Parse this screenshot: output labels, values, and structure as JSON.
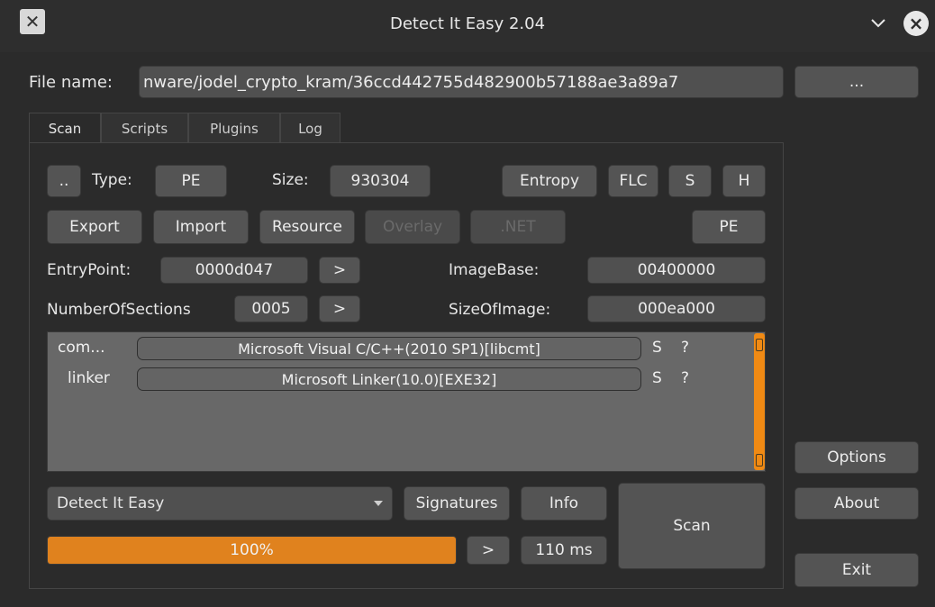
{
  "window": {
    "title": "Detect It Easy 2.04",
    "app_icon_glyph": "✕"
  },
  "file": {
    "label": "File name:",
    "value": "nware/jodel_crypto_kram/36ccd442755d482900b57188ae3a89a7",
    "browse_label": "..."
  },
  "tabs": [
    {
      "label": "Scan",
      "active": true
    },
    {
      "label": "Scripts",
      "active": false
    },
    {
      "label": "Plugins",
      "active": false
    },
    {
      "label": "Log",
      "active": false
    }
  ],
  "scan": {
    "dotdot_label": "..",
    "type_label": "Type:",
    "type_value": "PE",
    "size_label": "Size:",
    "size_value": "930304",
    "entropy_label": "Entropy",
    "flc_label": "FLC",
    "s_label": "S",
    "h_label": "H",
    "export_label": "Export",
    "import_label": "Import",
    "resource_label": "Resource",
    "overlay_label": "Overlay",
    "net_label": ".NET",
    "pe_label": "PE",
    "entrypoint_label": "EntryPoint:",
    "entrypoint_value": "0000d047",
    "entrypoint_go": ">",
    "imagebase_label": "ImageBase:",
    "imagebase_value": "00400000",
    "sections_label": "NumberOfSections",
    "sections_value": "0005",
    "sections_go": ">",
    "sizeofimage_label": "SizeOfImage:",
    "sizeofimage_value": "000ea000"
  },
  "results": [
    {
      "type": "com...",
      "name": "Microsoft Visual C/C++(2010 SP1)[libcmt]",
      "s": "S",
      "q": "?"
    },
    {
      "type": "linker",
      "name": "Microsoft Linker(10.0)[EXE32]",
      "s": "S",
      "q": "?"
    }
  ],
  "bottom": {
    "engine_value": "Detect It Easy",
    "signatures_label": "Signatures",
    "info_label": "Info",
    "scan_label": "Scan",
    "progress_percent": 100,
    "progress_text": "100%",
    "more_label": ">",
    "time_value": "110 ms"
  },
  "side": {
    "options_label": "Options",
    "about_label": "About",
    "exit_label": "Exit"
  },
  "colors": {
    "accent": "#e0821e",
    "background": "#2b2b2b",
    "button": "#545454"
  }
}
